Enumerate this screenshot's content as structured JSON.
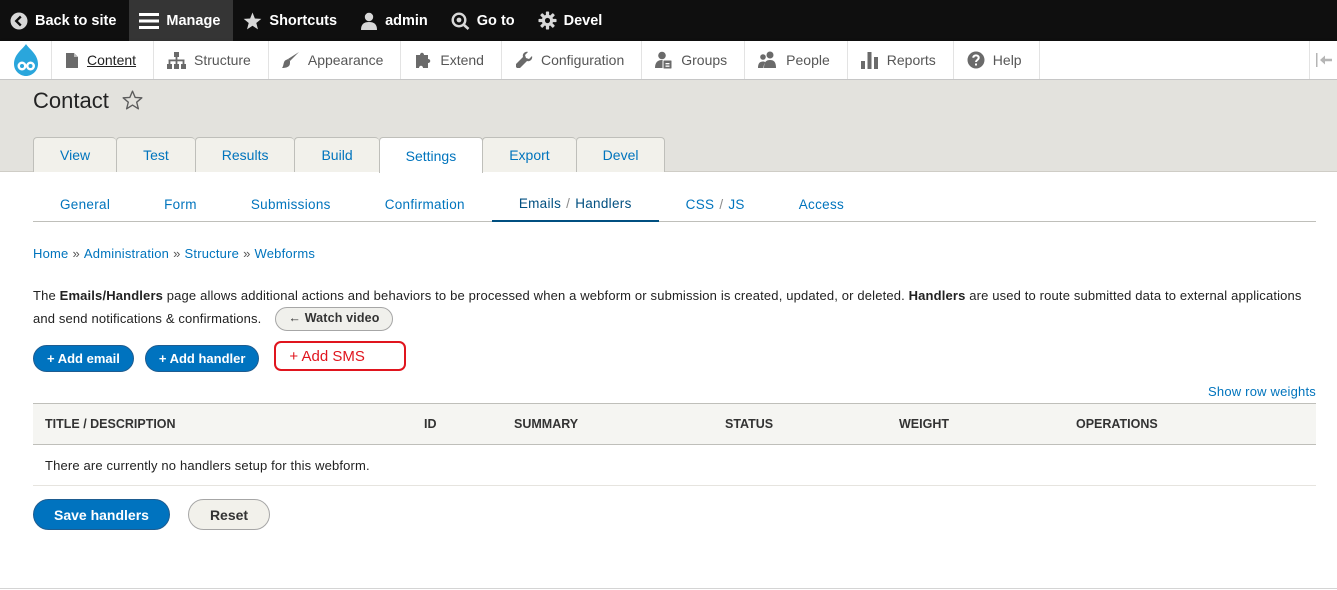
{
  "toolbar": {
    "back_to_site": "Back to site",
    "manage": "Manage",
    "shortcuts": "Shortcuts",
    "user": "admin",
    "go_to": "Go to",
    "devel": "Devel"
  },
  "tray": {
    "items": [
      {
        "label": "Content",
        "icon": "file-icon"
      },
      {
        "label": "Structure",
        "icon": "sitemap-icon"
      },
      {
        "label": "Appearance",
        "icon": "paintbrush-icon"
      },
      {
        "label": "Extend",
        "icon": "puzzle-icon"
      },
      {
        "label": "Configuration",
        "icon": "wrench-icon"
      },
      {
        "label": "Groups",
        "icon": "groups-icon"
      },
      {
        "label": "People",
        "icon": "people-icon"
      },
      {
        "label": "Reports",
        "icon": "bar-chart-icon"
      },
      {
        "label": "Help",
        "icon": "help-icon"
      }
    ]
  },
  "page": {
    "title": "Contact"
  },
  "primary_tabs": [
    "View",
    "Test",
    "Results",
    "Build",
    "Settings",
    "Export",
    "Devel"
  ],
  "secondary_tabs": {
    "general": "General",
    "form": "Form",
    "submissions": "Submissions",
    "confirmation": "Confirmation",
    "emails": "Emails",
    "emails_sep": "/",
    "handlers": "Handlers",
    "css": "CSS",
    "css_sep": "/",
    "js": "JS",
    "access": "Access"
  },
  "breadcrumb": [
    "Home",
    "Administration",
    "Structure",
    "Webforms"
  ],
  "breadcrumb_separator": "»",
  "description": {
    "part1": "The ",
    "bold1": "Emails/Handlers",
    "part2": " page allows additional actions and behaviors to be processed when a webform or submission is created, updated, or deleted. ",
    "bold2": "Handlers",
    "part3": " are used to route submitted data to external applications and send notifications & confirmations.",
    "watch_video": "← Watch video"
  },
  "actions": {
    "add_email": "+ Add email",
    "add_handler": "+ Add handler",
    "add_sms": "+ Add SMS"
  },
  "table": {
    "show_row_weights": "Show row weights",
    "headers": [
      "TITLE / DESCRIPTION",
      "ID",
      "SUMMARY",
      "STATUS",
      "WEIGHT",
      "OPERATIONS"
    ],
    "empty_message": "There are currently no handlers setup for this webform."
  },
  "form_actions": {
    "save": "Save handlers",
    "reset": "Reset"
  },
  "colors": {
    "toolbar_bg": "#0f0f0f",
    "link_blue": "#0074bd",
    "button_blue": "#0073bf",
    "highlight_red": "#e0151e",
    "header_bg": "#e3e2dd"
  }
}
